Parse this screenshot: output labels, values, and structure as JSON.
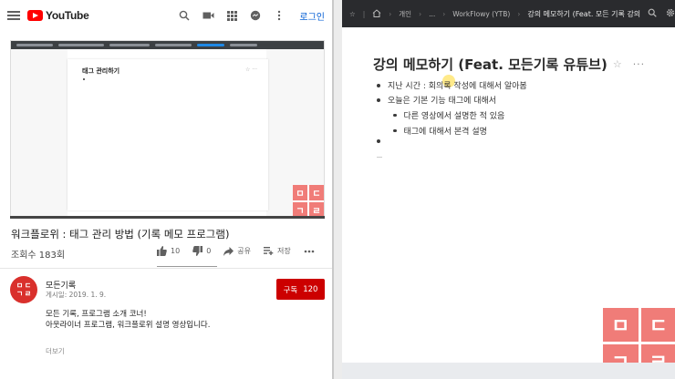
{
  "youtube": {
    "logo_text": "YouTube",
    "login_label": "로그인",
    "icons": [
      "menu-icon",
      "search-icon",
      "camera-icon",
      "apps-icon",
      "chat-icon",
      "more-icon"
    ],
    "player": {
      "inner_title": "태그 관리하기",
      "watermark": [
        "ㅁ",
        "ㄷ",
        "ㄱ",
        "ㄹ"
      ]
    },
    "video_title": "워크플로위 : 태그 관리 방법 (기록 메모 프로그램)",
    "views": "조회수 183회",
    "likes": "10",
    "dislikes": "0",
    "share_label": "공유",
    "save_label": "저장",
    "channel_name": "모든기록",
    "publish_date": "게시일: 2019. 1. 9.",
    "subscribe_label": "구독",
    "subscriber_count": "120",
    "description_lines": [
      "모든 기록, 프로그램 소개 코너!",
      "아웃라이너 프로그램, 워크플로위 설명 영상입니다."
    ],
    "more_label": "더보기",
    "brand_red": "#ff0000"
  },
  "workflowy": {
    "breadcrumbs": [
      "개인",
      "...",
      "WorkFlowy (YTB)",
      "강의 메모하기 (Feat. 모든 기록 강의"
    ],
    "title": "강의 메모하기 (Feat. 모든기록 유튜브)",
    "items": [
      {
        "text": "지난 시간 : 회의록 작성에 대해서 알아봄"
      },
      {
        "text": "오늘은 기본 기능 태그에 대해서"
      },
      {
        "text": "다른 영상에서 설명한 적 있음",
        "sub": true
      },
      {
        "text": "태그에 대해서 본격 설명",
        "sub": true
      },
      {
        "text": ""
      }
    ],
    "watermark": [
      "ㅁ",
      "ㄷ",
      "ㄱ",
      "ㄹ"
    ],
    "watermark_color": "#f07c78"
  }
}
